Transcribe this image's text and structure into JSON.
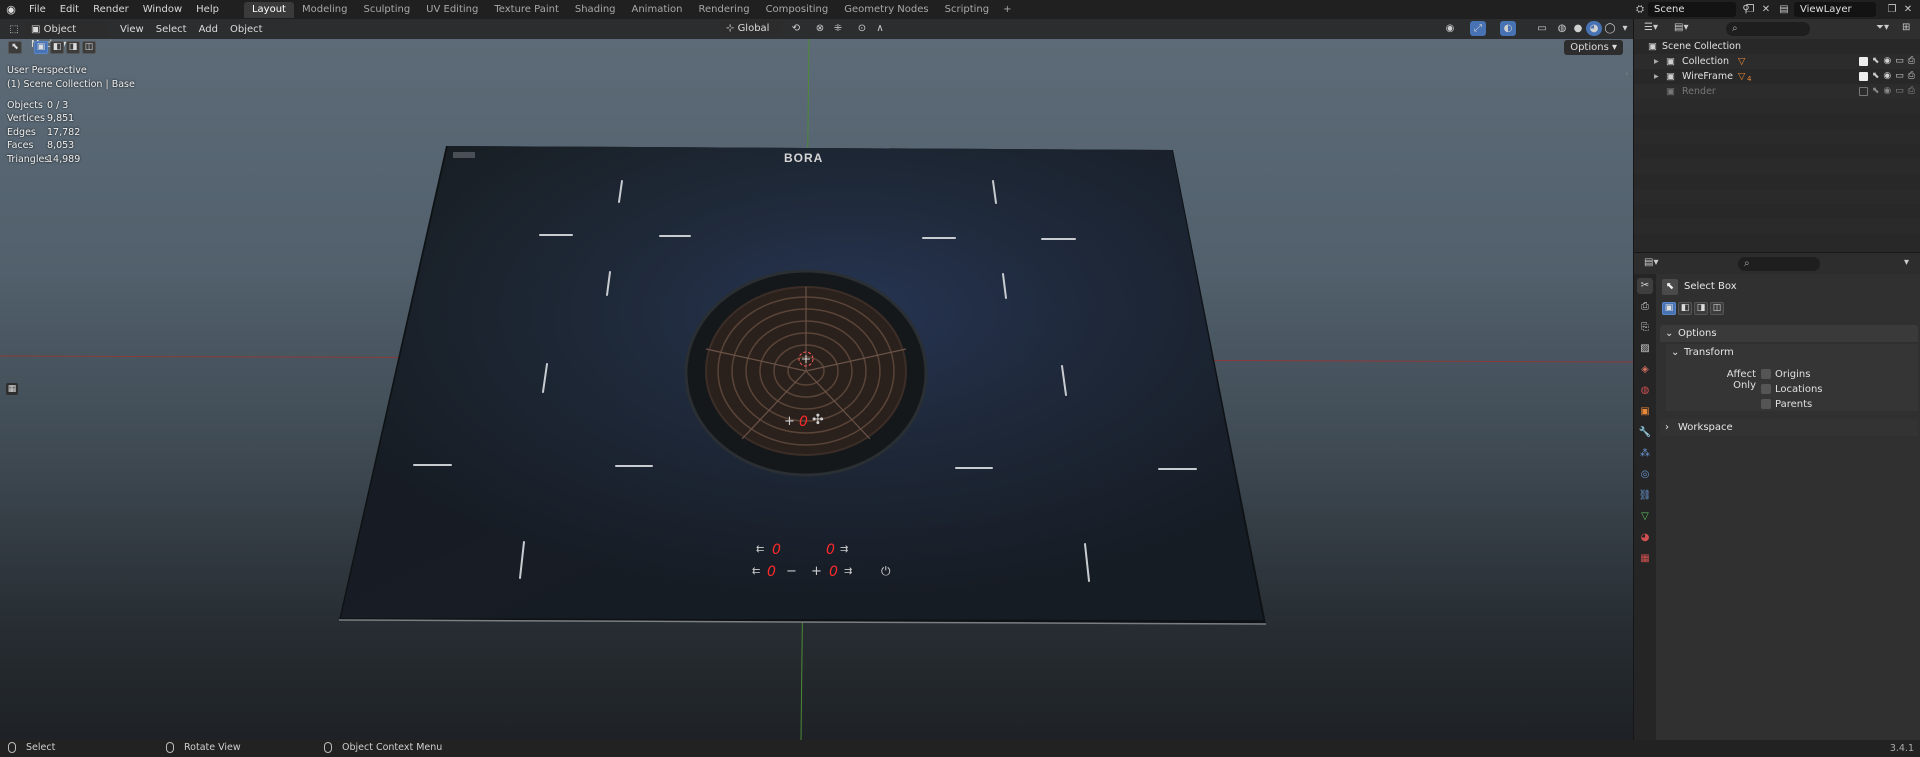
{
  "app": {
    "menu": [
      "File",
      "Edit",
      "Render",
      "Window",
      "Help"
    ],
    "workspaces": [
      "Layout",
      "Modeling",
      "Sculpting",
      "UV Editing",
      "Texture Paint",
      "Shading",
      "Animation",
      "Rendering",
      "Compositing",
      "Geometry Nodes",
      "Scripting"
    ],
    "active_workspace": "Layout",
    "add_tab": "+",
    "scene": "Scene",
    "view_layer": "ViewLayer"
  },
  "viewport": {
    "mode": "Object Mode",
    "menus": [
      "View",
      "Select",
      "Add",
      "Object"
    ],
    "transform_orientation": "Global",
    "options_label": "Options",
    "perspective": "User Perspective",
    "collection_path": "(1) Scene Collection | Base",
    "stats": [
      {
        "label": "Objects",
        "value": "0 / 3"
      },
      {
        "label": "Vertices",
        "value": "9,851"
      },
      {
        "label": "Edges",
        "value": "17,782"
      },
      {
        "label": "Faces",
        "value": "8,053"
      },
      {
        "label": "Triangles",
        "value": "14,989"
      }
    ],
    "brand": "BORA",
    "hob_readouts": {
      "fan": "0",
      "top_left": "0",
      "top_right": "0",
      "bottom_left": "0",
      "bottom_right": "0",
      "minus": "−",
      "plus": "+"
    }
  },
  "outliner": {
    "root": "Scene Collection",
    "items": [
      {
        "label": "Collection",
        "badge": "",
        "enabled": true
      },
      {
        "label": "WireFrame",
        "badge": "4",
        "enabled": true
      },
      {
        "label": "Render",
        "badge": "",
        "enabled": false
      }
    ]
  },
  "properties": {
    "tool_name": "Select Box",
    "panels": {
      "options": "Options",
      "transform": "Transform",
      "affect_only": "Affect Only",
      "origins": "Origins",
      "locations": "Locations",
      "parents": "Parents",
      "workspace": "Workspace"
    }
  },
  "status": {
    "select": "Select",
    "rotate": "Rotate View",
    "context": "Object Context Menu",
    "version": "3.4.1"
  },
  "colors": {
    "accent": "#4772b3",
    "readout_red": "#ff2a2a",
    "x_axis": "#a33a3a",
    "y_axis": "#6aa33a"
  }
}
